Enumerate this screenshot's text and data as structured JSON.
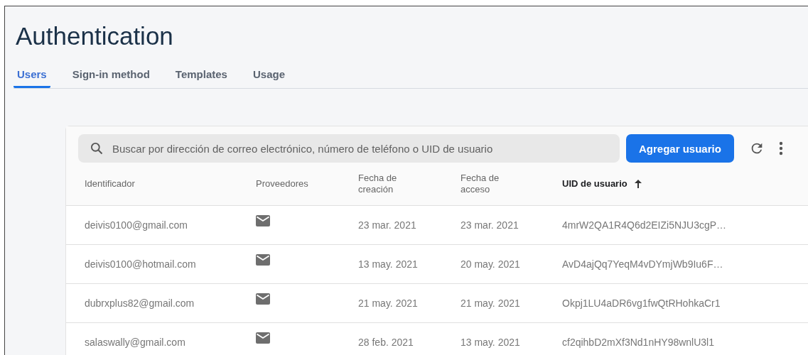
{
  "title": "Authentication",
  "tabs": [
    {
      "label": "Users",
      "selected": true
    },
    {
      "label": "Sign-in method",
      "selected": false
    },
    {
      "label": "Templates",
      "selected": false
    },
    {
      "label": "Usage",
      "selected": false
    }
  ],
  "search": {
    "placeholder": "Buscar por dirección de correo electrónico, número de teléfono o UID de usuario"
  },
  "add_button": "Agregar usuario",
  "table": {
    "columns": [
      {
        "label": "Identificador",
        "sorted": false
      },
      {
        "label": "Proveedores",
        "sorted": false
      },
      {
        "label": "Fecha de creación",
        "sorted": false
      },
      {
        "label": "Fecha de acceso",
        "sorted": false
      },
      {
        "label": "UID de usuario",
        "sorted": true
      }
    ],
    "rows": [
      {
        "identifier": "deivis0100@gmail.com",
        "provider": {
          "kind": "email"
        },
        "created": "23 mar. 2021",
        "accessed": "23 mar. 2021",
        "uid": "4mrW2QA1R4Q6d2EIZi5NJU3cgP…"
      },
      {
        "identifier": "deivis0100@hotmail.com",
        "provider": {
          "kind": "email"
        },
        "created": "13 may. 2021",
        "accessed": "20 may. 2021",
        "uid": "AvD4ajQq7YeqM4vDYmjWb9Iu6F…"
      },
      {
        "identifier": "dubrxplus82@gmail.com",
        "provider": {
          "kind": "email"
        },
        "created": "21 may. 2021",
        "accessed": "21 may. 2021",
        "uid": "Okpj1LU4aDR6vg1fwQtRHohkaCr1"
      },
      {
        "identifier": "salaswally@gmail.com",
        "provider": {
          "kind": "email"
        },
        "created": "28 feb. 2021",
        "accessed": "13 may. 2021",
        "uid": "cf2qihbD2mXf3Nd1nHY98wnlU3l1"
      }
    ]
  }
}
